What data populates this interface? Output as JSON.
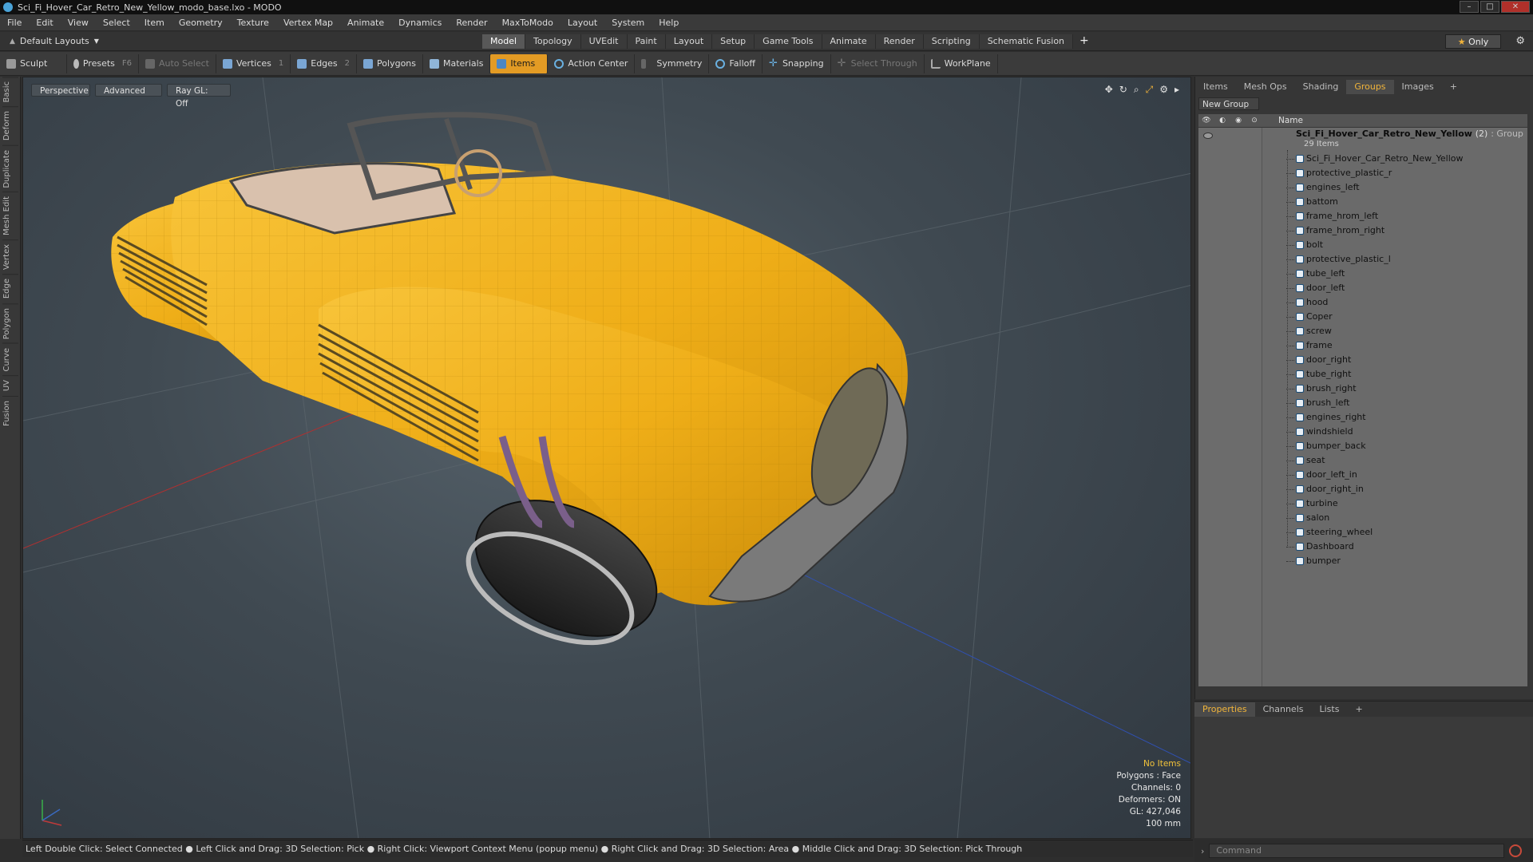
{
  "window": {
    "title": "Sci_Fi_Hover_Car_Retro_New_Yellow_modo_base.lxo - MODO",
    "min": "–",
    "max": "□",
    "close": "✕"
  },
  "menu": [
    "File",
    "Edit",
    "View",
    "Select",
    "Item",
    "Geometry",
    "Texture",
    "Vertex Map",
    "Animate",
    "Dynamics",
    "Render",
    "MaxToModo",
    "Layout",
    "System",
    "Help"
  ],
  "layout": {
    "label": "Default Layouts",
    "tabs": [
      "Model",
      "Topology",
      "UVEdit",
      "Paint",
      "Layout",
      "Setup",
      "Game Tools",
      "Animate",
      "Render",
      "Scripting",
      "Schematic Fusion"
    ],
    "active_tab": "Model",
    "plus": "+",
    "only": "Only"
  },
  "toolbar": {
    "sculpt": "Sculpt",
    "presets": "Presets",
    "presets_key": "F6",
    "auto_select": "Auto Select",
    "vertices": "Vertices",
    "vertices_count": "1",
    "edges": "Edges",
    "edges_count": "2",
    "polygons": "Polygons",
    "materials": "Materials",
    "items": "Items",
    "action_center": "Action Center",
    "symmetry": "Symmetry",
    "falloff": "Falloff",
    "snapping": "Snapping",
    "select_through": "Select Through",
    "workplane": "WorkPlane"
  },
  "left_tabs": [
    "Basic",
    "Deform",
    "Duplicate",
    "Mesh Edit",
    "Vertex",
    "Edge",
    "Polygon",
    "Curve",
    "UV",
    "Fusion"
  ],
  "viewport": {
    "view": "Perspective",
    "shading": "Advanced",
    "raygl": "Ray GL: Off",
    "info": {
      "no_items": "No Items",
      "polygons": "Polygons : Face",
      "channels": "Channels: 0",
      "deformers": "Deformers: ON",
      "gl": "GL: 427,046",
      "scale": "100 mm"
    }
  },
  "status": "Left Double Click: Select Connected ● Left Click and Drag: 3D Selection: Pick ● Right Click: Viewport Context Menu (popup menu) ● Right Click and Drag: 3D Selection: Area ● Middle Click and Drag: 3D Selection: Pick Through",
  "command_placeholder": "Command",
  "panel": {
    "tabs": [
      "Items",
      "Mesh Ops",
      "Shading",
      "Groups",
      "Images"
    ],
    "active_tab": "Groups",
    "plus": "+",
    "new_group": "New Group",
    "name_header": "Name",
    "group": {
      "name": "Sci_Fi_Hover_Car_Retro_New_Yellow",
      "count": "(2)",
      "type": ": Group",
      "items": "29 Items"
    },
    "children": [
      "Sci_Fi_Hover_Car_Retro_New_Yellow",
      "protective_plastic_r",
      "engines_left",
      "battom",
      "frame_hrom_left",
      "frame_hrom_right",
      "bolt",
      "protective_plastic_l",
      "tube_left",
      "door_left",
      "hood",
      "Coper",
      "screw",
      "frame",
      "door_right",
      "tube_right",
      "brush_right",
      "brush_left",
      "engines_right",
      "windshield",
      "bumper_back",
      "seat",
      "door_left_in",
      "door_right_in",
      "turbine",
      "salon",
      "steering_wheel",
      "Dashboard",
      "bumper"
    ]
  },
  "properties": {
    "tabs": [
      "Properties",
      "Channels",
      "Lists"
    ],
    "active_tab": "Properties",
    "plus": "+"
  },
  "colors": {
    "accent": "#e39b24",
    "car_body": "#f2b21a",
    "viewport_bg": "#404a52"
  }
}
